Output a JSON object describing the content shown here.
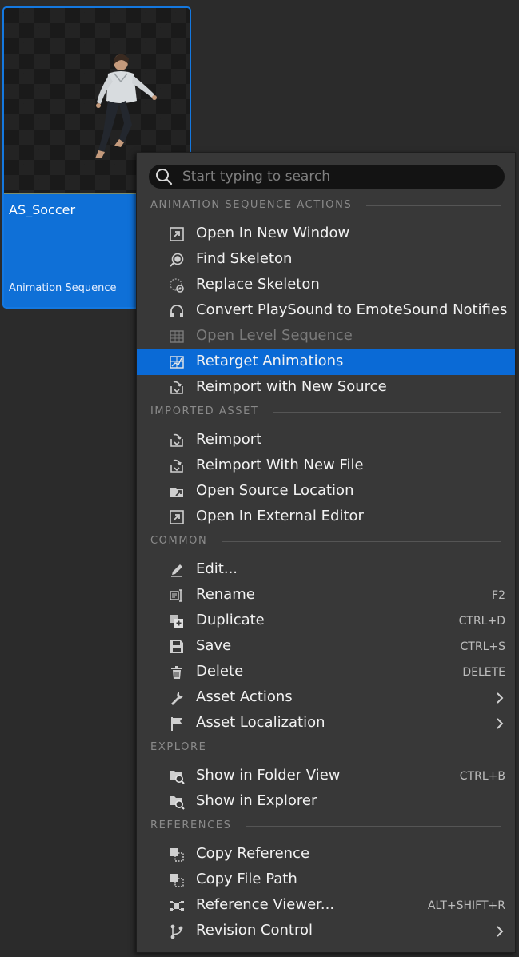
{
  "asset": {
    "name": "AS_Soccer",
    "type": "Animation Sequence"
  },
  "search": {
    "placeholder": "Start typing to search"
  },
  "sections": [
    {
      "label": "ANIMATION SEQUENCE ACTIONS",
      "items": [
        {
          "label": "Open In New Window",
          "icon": "open-window-icon"
        },
        {
          "label": "Find Skeleton",
          "icon": "find-skeleton-icon"
        },
        {
          "label": "Replace Skeleton",
          "icon": "replace-skeleton-icon"
        },
        {
          "label": "Convert PlaySound to EmoteSound Notifies",
          "icon": "headphones-icon"
        },
        {
          "label": "Open Level Sequence",
          "icon": "level-sequence-icon",
          "disabled": true
        },
        {
          "label": "Retarget Animations",
          "icon": "retarget-icon",
          "selected": true
        },
        {
          "label": "Reimport with New Source",
          "icon": "reimport-icon"
        }
      ]
    },
    {
      "label": "IMPORTED ASSET",
      "items": [
        {
          "label": "Reimport",
          "icon": "reimport-icon"
        },
        {
          "label": "Reimport With New File",
          "icon": "reimport-icon"
        },
        {
          "label": "Open Source Location",
          "icon": "folder-open-icon"
        },
        {
          "label": "Open In External Editor",
          "icon": "open-window-icon"
        }
      ]
    },
    {
      "label": "COMMON",
      "items": [
        {
          "label": "Edit...",
          "icon": "pencil-icon"
        },
        {
          "label": "Rename",
          "icon": "rename-icon",
          "shortcut": "F2"
        },
        {
          "label": "Duplicate",
          "icon": "duplicate-icon",
          "shortcut": "CTRL+D"
        },
        {
          "label": "Save",
          "icon": "save-icon",
          "shortcut": "CTRL+S"
        },
        {
          "label": "Delete",
          "icon": "trash-icon",
          "shortcut": "DELETE"
        },
        {
          "label": "Asset Actions",
          "icon": "wrench-icon",
          "submenu": true
        },
        {
          "label": "Asset Localization",
          "icon": "flag-icon",
          "submenu": true
        }
      ]
    },
    {
      "label": "EXPLORE",
      "items": [
        {
          "label": "Show in Folder View",
          "icon": "folder-search-icon",
          "shortcut": "CTRL+B"
        },
        {
          "label": "Show in Explorer",
          "icon": "folder-search-icon"
        }
      ]
    },
    {
      "label": "REFERENCES",
      "items": [
        {
          "label": "Copy Reference",
          "icon": "copy-reference-icon"
        },
        {
          "label": "Copy File Path",
          "icon": "copy-reference-icon"
        },
        {
          "label": "Reference Viewer...",
          "icon": "reference-viewer-icon",
          "shortcut": "ALT+SHIFT+R"
        },
        {
          "label": "Revision Control",
          "icon": "branch-icon",
          "submenu": true
        }
      ]
    }
  ],
  "colors": {
    "selection": "#0a6ad6",
    "menu_bg": "#383838",
    "tile_bg": "#0f70d7"
  }
}
